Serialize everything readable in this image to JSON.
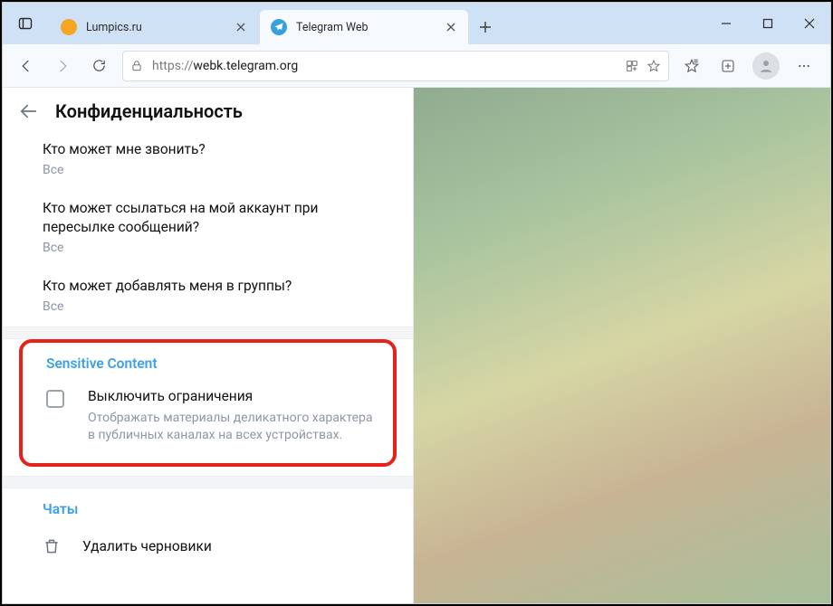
{
  "tabs": [
    {
      "title": "Lumpics.ru",
      "active": false
    },
    {
      "title": "Telegram Web",
      "active": true
    }
  ],
  "url": {
    "scheme": "https://",
    "host": "webk.telegram.org"
  },
  "panel": {
    "title": "Конфиденциальность",
    "settings": [
      {
        "q": "Кто может мне звонить?",
        "v": "Все"
      },
      {
        "q": "Кто может ссылаться на мой аккаунт при пересылке сообщений?",
        "v": "Все"
      },
      {
        "q": "Кто может добавлять меня в группы?",
        "v": "Все"
      }
    ],
    "sensitive": {
      "header": "Sensitive Content",
      "toggle_title": "Выключить ограничения",
      "toggle_desc": "Отображать материалы деликатного характера в публичных каналах на всех устройствах."
    },
    "chats_header": "Чаты",
    "delete_drafts": "Удалить черновики"
  }
}
